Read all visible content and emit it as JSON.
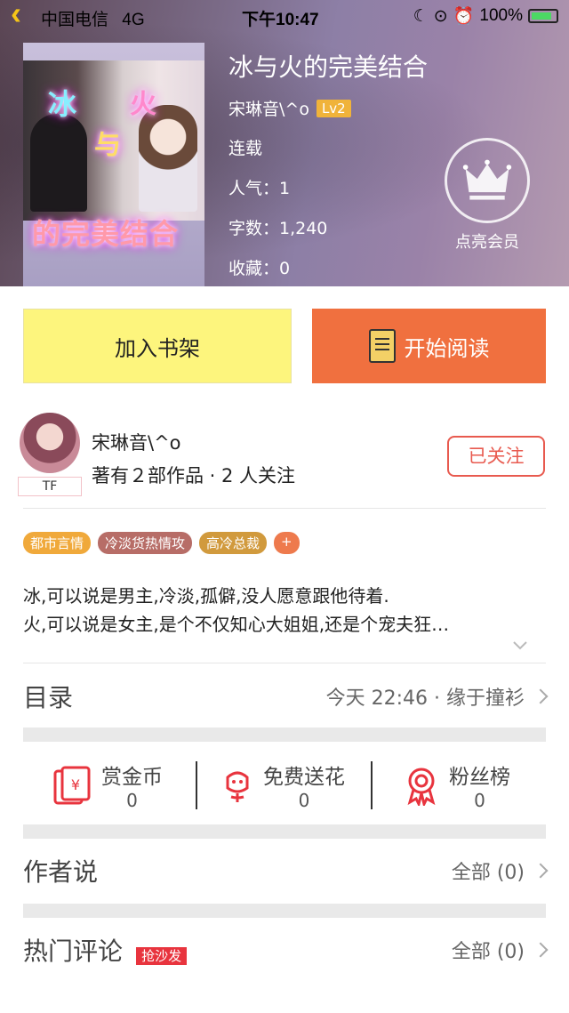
{
  "status_bar": {
    "carrier": "中国电信",
    "network": "4G",
    "time": "下午10:47",
    "battery": "100%"
  },
  "book": {
    "title": "冰与火的完美结合",
    "author": "宋琳音\\^o",
    "level": "Lv2",
    "status": "连载",
    "popularity": "人气：1",
    "word_count": "字数：1,240",
    "favorites": "收藏：0",
    "cover_text": {
      "c1": "冰",
      "c2": "火",
      "c3": "与",
      "c4": "的完美结合"
    }
  },
  "vip": {
    "label": "点亮会员"
  },
  "actions": {
    "add_shelf": "加入书架",
    "start_reading": "开始阅读"
  },
  "author_card": {
    "name": "宋琳音\\^o",
    "stats": "著有２部作品 · 2 人关注",
    "badge": "TF",
    "follow_label": "已关注"
  },
  "tags": [
    {
      "label": "都市言情",
      "color": "#f0a93b"
    },
    {
      "label": "冷淡货热情攻",
      "color": "#b76d67"
    },
    {
      "label": "高冷总裁",
      "color": "#d19a3d"
    },
    {
      "label": "+",
      "color": "#ee7a4d"
    }
  ],
  "description": {
    "line1": "冰,可以说是男主,冷淡,孤僻,没人愿意跟他待着.",
    "line2": "火,可以说是女主,是个不仅知心大姐姐,还是个宠夫狂…"
  },
  "catalog": {
    "title": "目录",
    "latest": "今天 22:46 · 缘于撞衫"
  },
  "rewards": [
    {
      "label": "赏金币",
      "count": "0",
      "icon": "red-envelope-icon"
    },
    {
      "label": "免费送花",
      "count": "0",
      "icon": "flower-icon"
    },
    {
      "label": "粉丝榜",
      "count": "0",
      "icon": "medal-icon"
    }
  ],
  "author_says": {
    "title": "作者说",
    "all_label": "全部 (0)"
  },
  "hot_comments": {
    "title": "热门评论",
    "badge": "抢沙发",
    "all_label": "全部 (0)"
  }
}
